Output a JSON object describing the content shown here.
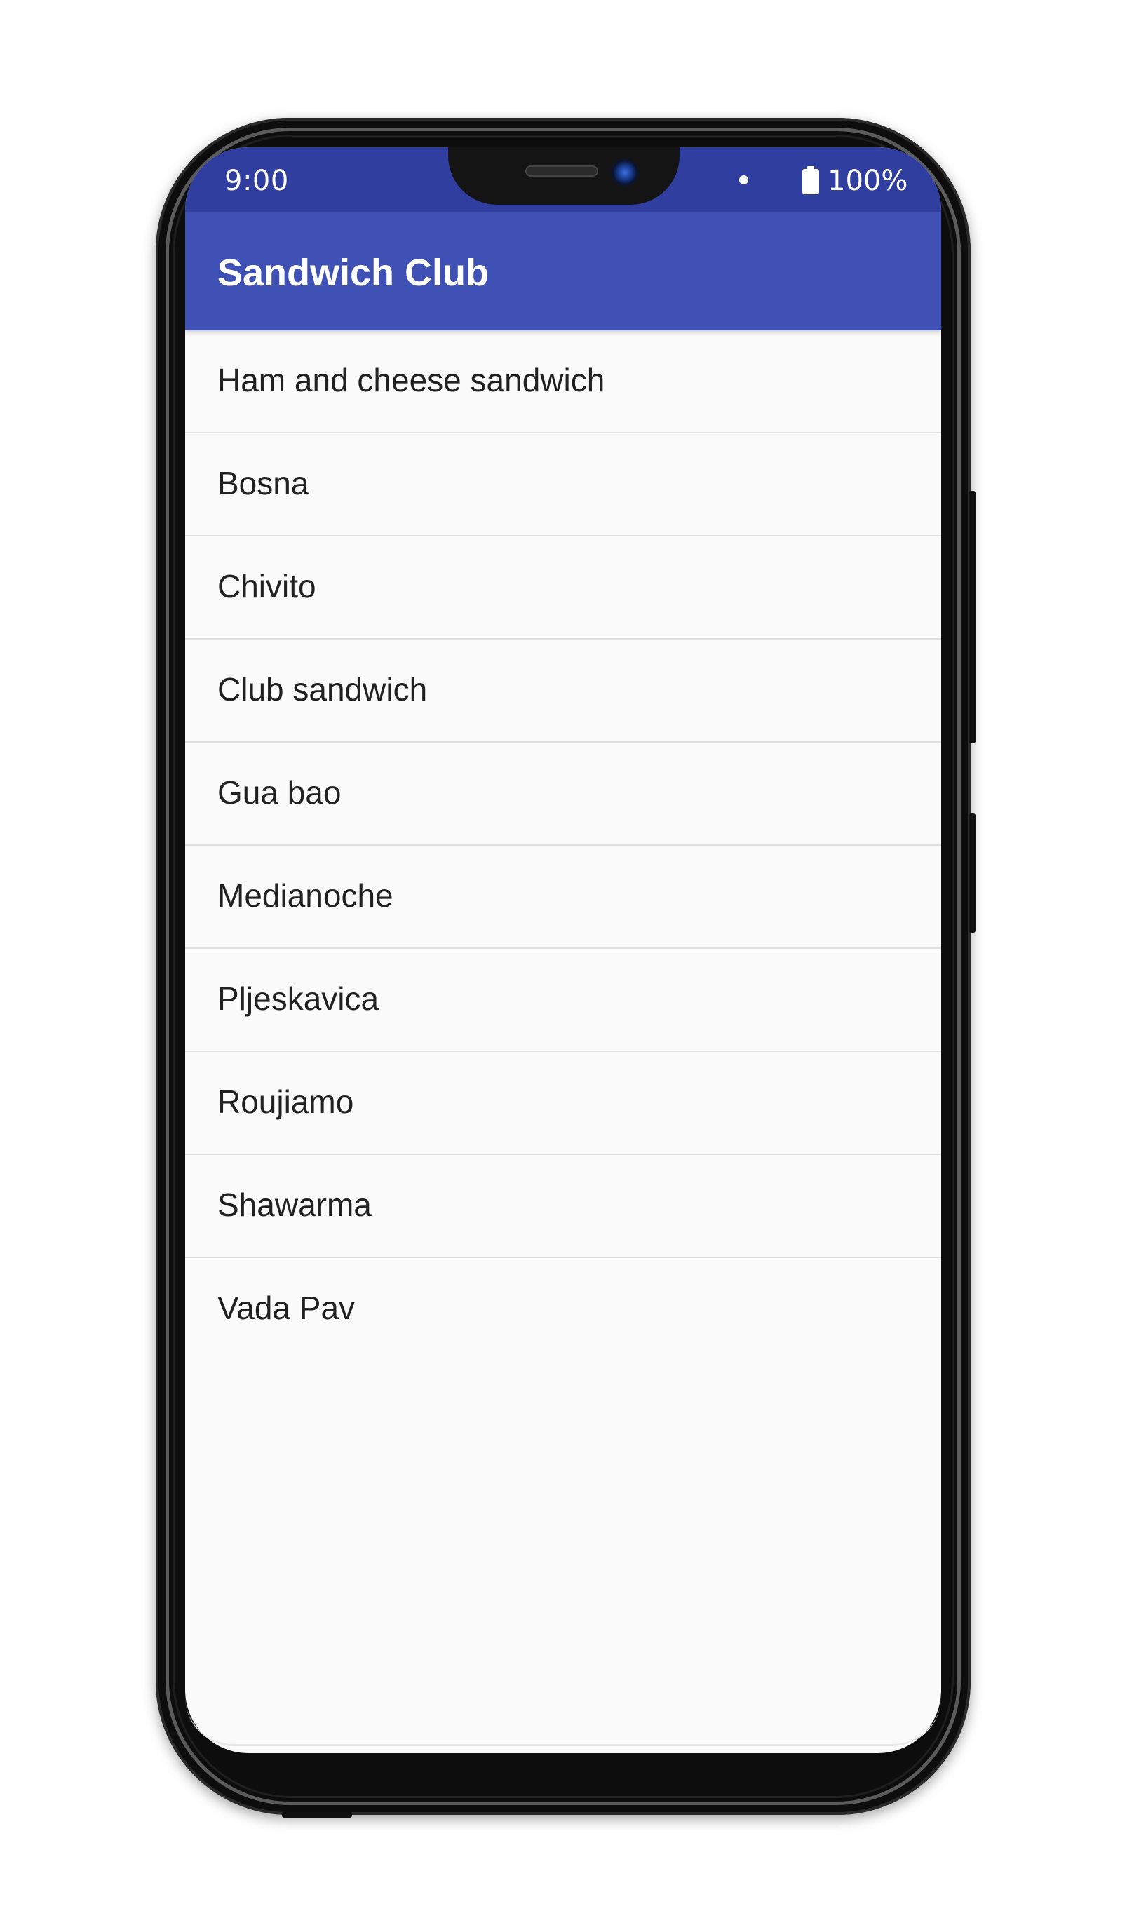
{
  "status_bar": {
    "time": "9:00",
    "battery": "100%",
    "icons": [
      "notification-dot-icon",
      "battery-icon"
    ]
  },
  "app_bar": {
    "title": "Sandwich Club"
  },
  "sandwiches": [
    "Ham and cheese sandwich",
    "Bosna",
    "Chivito",
    "Club sandwich",
    "Gua bao",
    "Medianoche",
    "Pljeskavica",
    "Roujiamo",
    "Shawarma",
    "Vada Pav"
  ],
  "colors": {
    "status_bar": "#303f9f",
    "app_bar": "#3f51b5",
    "background": "#fafafa",
    "divider": "#e0e0e0",
    "text": "#212121"
  }
}
